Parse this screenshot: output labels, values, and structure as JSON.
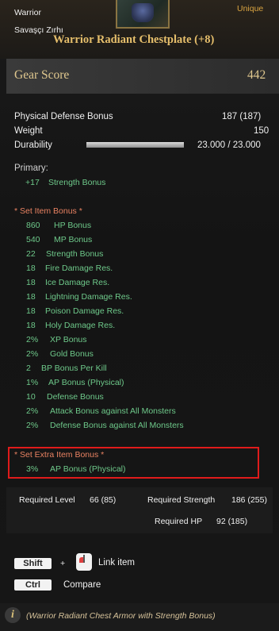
{
  "header": {
    "class_label": "Warrior",
    "subname": "Savaşçı Zırhı",
    "rarity": "Unique",
    "item_name": "Warrior Radiant Chestplate (+8)",
    "icon": "armor-thumbnail-icon"
  },
  "gear_score": {
    "label": "Gear Score",
    "value": "442"
  },
  "stats": {
    "physical_defense_label": "Physical Defense Bonus",
    "physical_defense_value": "187 (187)",
    "weight_label": "Weight",
    "weight_value": "150",
    "durability_label": "Durability",
    "durability_value": "23.000 / 23.000",
    "durability_fraction": 1.0
  },
  "primary": {
    "heading": "Primary:",
    "value": "+17",
    "name": "Strength Bonus"
  },
  "set_bonus": {
    "heading": "* Set Item  Bonus *",
    "items": [
      {
        "value": "860",
        "name": "HP Bonus"
      },
      {
        "value": "540",
        "name": "MP Bonus"
      },
      {
        "value": "22",
        "name": "Strength Bonus"
      },
      {
        "value": "18",
        "name": "Fire Damage Res."
      },
      {
        "value": "18",
        "name": "Ice Damage Res."
      },
      {
        "value": "18",
        "name": "Lightning Damage Res."
      },
      {
        "value": "18",
        "name": "Poison Damage Res."
      },
      {
        "value": "18",
        "name": "Holy Damage Res."
      },
      {
        "value": "2%",
        "name": "XP Bonus"
      },
      {
        "value": "2%",
        "name": "Gold Bonus"
      },
      {
        "value": "2",
        "name": "BP Bonus Per Kill"
      },
      {
        "value": "1%",
        "name": "AP Bonus (Physical)"
      },
      {
        "value": "10",
        "name": "Defense Bonus"
      },
      {
        "value": "2%",
        "name": "Attack Bonus against All Monsters"
      },
      {
        "value": "2%",
        "name": "Defense Bonus against All Monsters"
      }
    ]
  },
  "set_extra": {
    "heading": "* Set Extra Item Bonus *",
    "value": "3%",
    "name": "AP Bonus (Physical)"
  },
  "requirements": {
    "level_label": "Required Level",
    "level_value": "66 (85)",
    "strength_label": "Required Strength",
    "strength_value": "186 (255)",
    "hp_label": "Required HP",
    "hp_value": "92 (185)"
  },
  "controls": {
    "shift_key": "Shift",
    "plus": "+",
    "mouse_icon": "mouse-left-click-icon",
    "link_label": "Link item",
    "ctrl_key": "Ctrl",
    "compare_label": "Compare"
  },
  "description": {
    "icon": "info-icon",
    "glyph": "i",
    "text": "(Warrior Radiant Chest Armor with Strength Bonus)"
  },
  "colors": {
    "title_gold": "#e6bf6c",
    "rarity_gold": "#d9a441",
    "bonus_green": "#6ec98a",
    "set_heading_salmon": "#e98262",
    "highlight_red": "#e01b1b"
  }
}
